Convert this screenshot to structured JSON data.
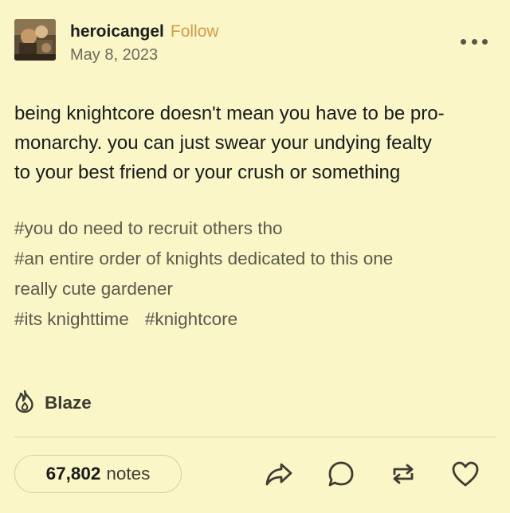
{
  "post": {
    "username": "heroicangel",
    "follow_label": "Follow",
    "date": "May 8, 2023",
    "body": "being knightcore doesn't mean you have to be pro-monarchy. you can just swear your undying fealty to your best friend or your crush or something",
    "body_lines": [
      "being knightcore doesn't mean you have to be pro-",
      "monarchy. you can just swear your undying fealty",
      "to your best friend or your crush or something"
    ],
    "tags": [
      "#you do need to recruit others tho",
      "#an entire order of knights dedicated to this one really cute gardener",
      "#its knighttime",
      "#knightcore"
    ],
    "tag_lines": {
      "tag1": "#you do need to recruit others tho",
      "tag2_line1": "#an entire order of knights dedicated to this one",
      "tag2_line2": "really cute gardener",
      "tag3": "#its knighttime",
      "tag4": "#knightcore"
    }
  },
  "blaze": {
    "label": "Blaze",
    "icon": "flame-icon"
  },
  "footer": {
    "notes_count": "67,802",
    "notes_label": "notes",
    "actions": [
      {
        "icon": "share-icon"
      },
      {
        "icon": "reply-icon"
      },
      {
        "icon": "reblog-icon"
      },
      {
        "icon": "heart-icon"
      }
    ]
  },
  "colors": {
    "background": "#faf6c8",
    "follow": "#d19b4b",
    "tags": "#5d5a4c",
    "icons": "#3e3b30"
  }
}
